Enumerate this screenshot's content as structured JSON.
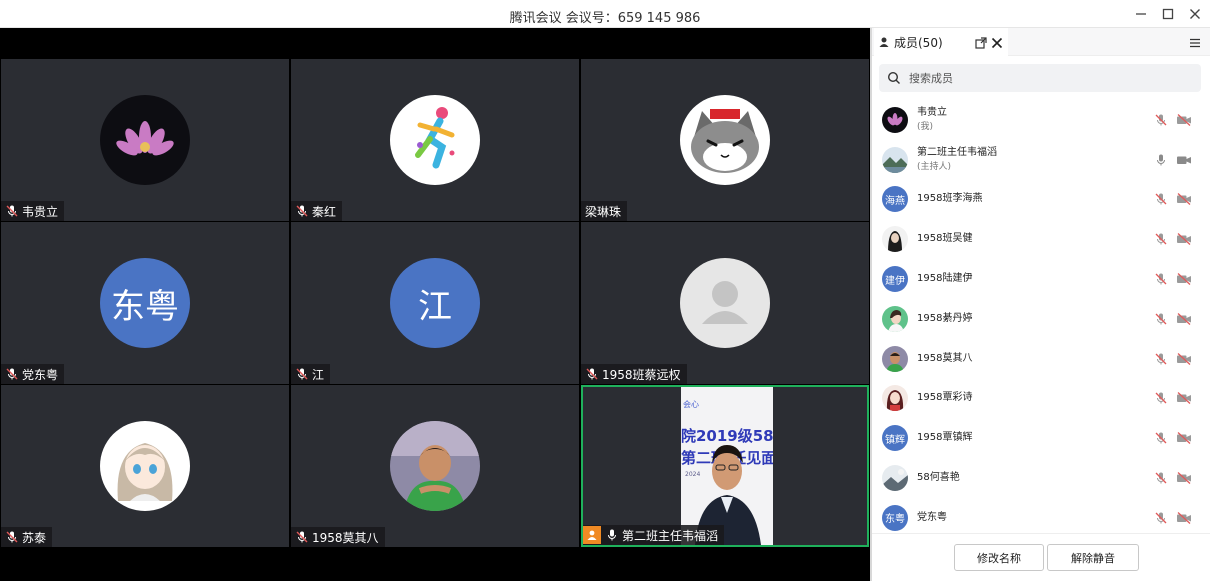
{
  "window": {
    "title": "腾讯会议 会议号：659 145 986"
  },
  "video_grid": {
    "tiles": [
      {
        "name": "韦贵立",
        "avatar": "lotus-photo",
        "muted": true
      },
      {
        "name": "秦红",
        "avatar": "runner-illustration",
        "muted": true
      },
      {
        "name": "梁琳珠",
        "avatar": "cat-cartoon",
        "muted": null
      },
      {
        "name": "党东粤",
        "avatar_text": "东粤",
        "muted": true
      },
      {
        "name": "江",
        "avatar_text": "江",
        "muted": true
      },
      {
        "name": "1958班蔡远权",
        "avatar": "default-person",
        "muted": true
      },
      {
        "name": "苏泰",
        "avatar": "anime-girl",
        "muted": true
      },
      {
        "name": "1958莫其八",
        "avatar": "boy-photo",
        "muted": true
      },
      {
        "name": "第二班主任韦福滔",
        "avatar": "live-camera",
        "muted": false,
        "speaking": true
      }
    ],
    "camera_banner": {
      "line1": "院2019级58班",
      "line2": "第二班  任见面"
    },
    "active_border_color": "#1fb15c"
  },
  "members_panel": {
    "tab_label": "成员(50)",
    "search_placeholder": "搜索成员",
    "members": [
      {
        "name": "韦贵立",
        "role": "(我)",
        "avatar": "lotus-photo",
        "mic_muted": true,
        "cam_off": true
      },
      {
        "name": "第二班主任韦福滔",
        "role": "(主持人)",
        "avatar": "landscape-photo",
        "mic_muted": false,
        "cam_off": false
      },
      {
        "name": "1958班李海燕",
        "avatar_text": "海燕",
        "mic_muted": true,
        "cam_off": true
      },
      {
        "name": "1958班吴健",
        "avatar": "portrait-photo",
        "mic_muted": true,
        "cam_off": true
      },
      {
        "name": "1958陆建伊",
        "avatar_text": "建伊",
        "mic_muted": true,
        "cam_off": true
      },
      {
        "name": "1958綦丹婷",
        "avatar": "girl-photo",
        "mic_muted": true,
        "cam_off": true
      },
      {
        "name": "1958莫其八",
        "avatar": "boy-photo",
        "mic_muted": true,
        "cam_off": true
      },
      {
        "name": "1958覃彩诗",
        "avatar": "doll-photo",
        "mic_muted": true,
        "cam_off": true
      },
      {
        "name": "1958覃镇辉",
        "avatar_text": "镇辉",
        "mic_muted": true,
        "cam_off": true
      },
      {
        "name": "58何喜艳",
        "avatar": "scenery-photo",
        "mic_muted": true,
        "cam_off": true
      },
      {
        "name": "党东粤",
        "avatar_text": "东粤",
        "mic_muted": true,
        "cam_off": true
      }
    ],
    "buttons": {
      "rename": "修改名称",
      "unmute": "解除静音"
    }
  },
  "colors": {
    "avatar_blue": "#4a74c4",
    "muted_red": "#e05a5a",
    "tile_bg": "#2b2d33",
    "speaker_orange": "#f08a24"
  }
}
